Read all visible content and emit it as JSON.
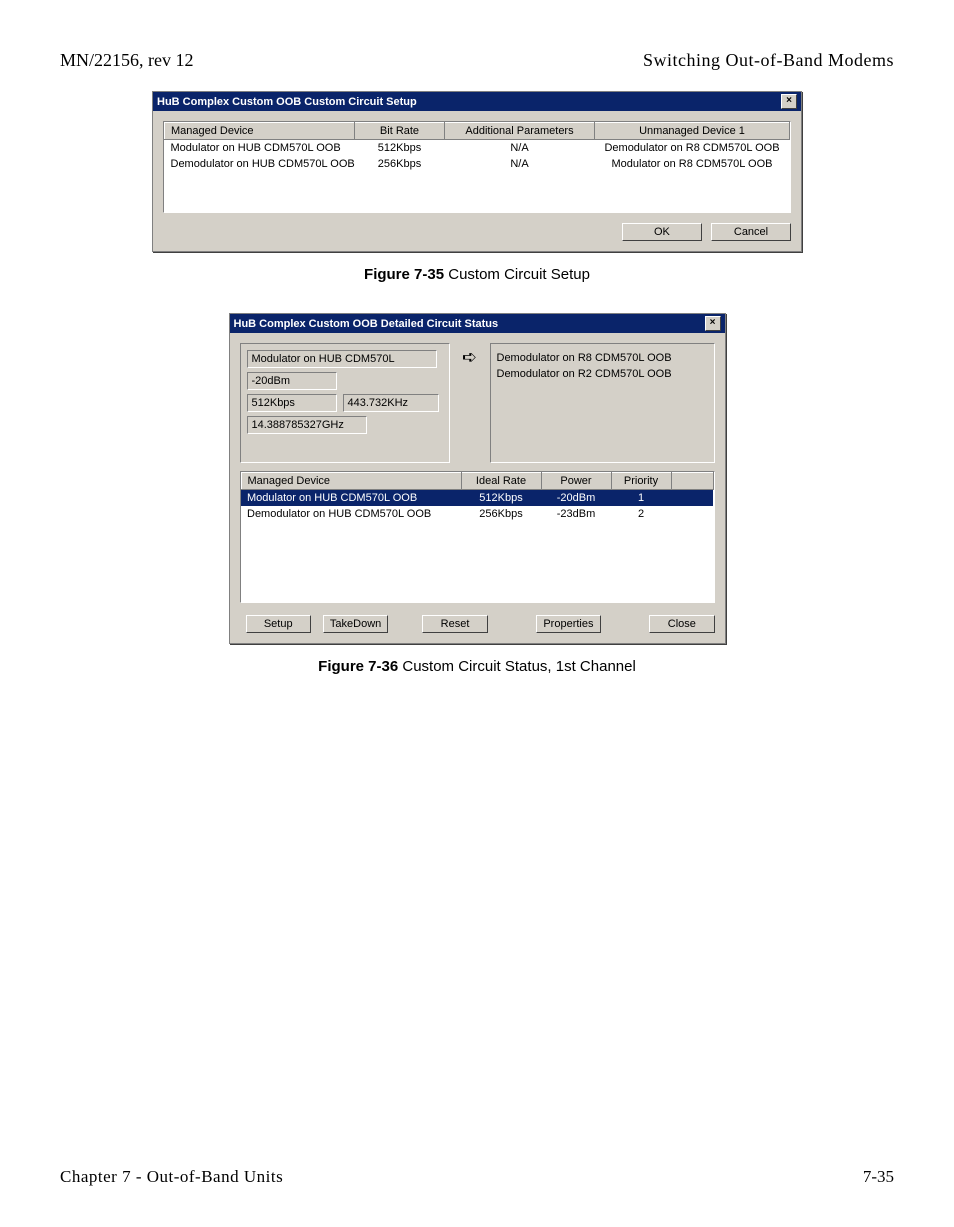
{
  "header": {
    "left": "MN/22156, rev 12",
    "right": "Switching Out-of-Band Modems"
  },
  "dialog1": {
    "title": "HuB Complex Custom OOB Custom Circuit Setup",
    "columns": [
      "Managed Device",
      "Bit Rate",
      "Additional Parameters",
      "Unmanaged Device 1"
    ],
    "rows": [
      {
        "device": "Modulator on HUB CDM570L OOB",
        "bitrate": "512Kbps",
        "params": "N/A",
        "unmanaged": "Demodulator on R8 CDM570L OOB"
      },
      {
        "device": "Demodulator on HUB CDM570L OOB",
        "bitrate": "256Kbps",
        "params": "N/A",
        "unmanaged": "Modulator on R8 CDM570L OOB"
      }
    ],
    "ok": "OK",
    "cancel": "Cancel"
  },
  "caption1": {
    "bold": "Figure 7-35",
    "rest": "   Custom Circuit Setup"
  },
  "dialog2": {
    "title": "HuB Complex Custom OOB Detailed Circuit Status",
    "left": {
      "name": "Modulator on HUB CDM570L",
      "power": "-20dBm",
      "rate": "512Kbps",
      "khz": "443.732KHz",
      "freq": "14.388785327GHz"
    },
    "right": {
      "line1": "Demodulator on R8 CDM570L OOB",
      "line2": "Demodulator on R2 CDM570L OOB"
    },
    "table": {
      "columns": [
        "Managed Device",
        "Ideal Rate",
        "Power",
        "Priority"
      ],
      "rows": [
        {
          "device": "Modulator on HUB CDM570L OOB",
          "rate": "512Kbps",
          "power": "-20dBm",
          "priority": "1",
          "selected": true
        },
        {
          "device": "Demodulator on HUB CDM570L OOB",
          "rate": "256Kbps",
          "power": "-23dBm",
          "priority": "2",
          "selected": false
        }
      ]
    },
    "buttons": {
      "setup": "Setup",
      "takedown": "TakeDown",
      "reset": "Reset",
      "properties": "Properties",
      "close": "Close"
    }
  },
  "caption2": {
    "bold": "Figure 7-36",
    "rest": "   Custom Circuit Status, 1st Channel"
  },
  "footer": {
    "left": "Chapter 7 - Out-of-Band Units",
    "right": "7-35"
  }
}
